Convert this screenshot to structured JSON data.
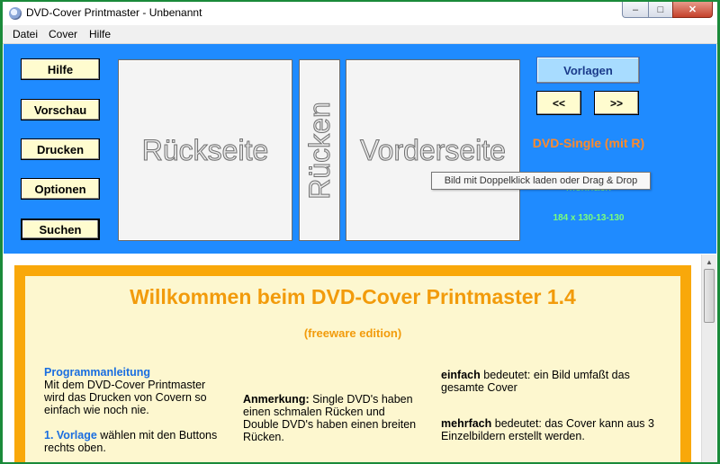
{
  "window": {
    "title": "DVD-Cover Printmaster - Unbenannt",
    "minimize": "–",
    "maximize": "□",
    "close": "✕"
  },
  "menu": {
    "items": [
      "Datei",
      "Cover",
      "Hilfe"
    ]
  },
  "left_buttons": [
    "Hilfe",
    "Vorschau",
    "Drucken",
    "Optionen",
    "Suchen"
  ],
  "cover": {
    "back": "Rückseite",
    "spine": "Rücken",
    "front": "Vorderseite"
  },
  "right": {
    "vorlagen": "Vorlagen",
    "prev": "<<",
    "next": ">>",
    "type": "DVD-Single (mit R)",
    "mode": "mehrfach",
    "dims": "184 x 130-13-130"
  },
  "tooltip": "Bild mit Doppelklick laden oder Drag & Drop",
  "welcome": {
    "title": "Willkommen beim DVD-Cover Printmaster 1.4",
    "edition": "(freeware edition)",
    "col1": {
      "heading": "Programmanleitung",
      "text": "Mit dem DVD-Cover Printmaster wird das Drucken von Covern so einfach wie noch nie.",
      "step_label": "1. Vorlage",
      "step_text": " wählen mit den Buttons rechts oben."
    },
    "col2": {
      "label": "Anmerkung:",
      "text": " Single DVD's haben einen schmalen Rücken und Double DVD's haben einen breiten Rücken."
    },
    "col3": {
      "simple_label": "einfach",
      "simple_text": " bedeutet: ein Bild umfaßt das gesamte Cover",
      "multi_label": "mehrfach",
      "multi_text": " bedeutet: das Cover kann aus 3 Einzelbildern erstellt werden."
    }
  },
  "colors": {
    "panel": "#1f8bff",
    "button": "#fffccf",
    "orange": "#f9a80a",
    "cream": "#fdf7cf",
    "accent_orange": "#f29b0b",
    "green": "#7aff7a"
  }
}
